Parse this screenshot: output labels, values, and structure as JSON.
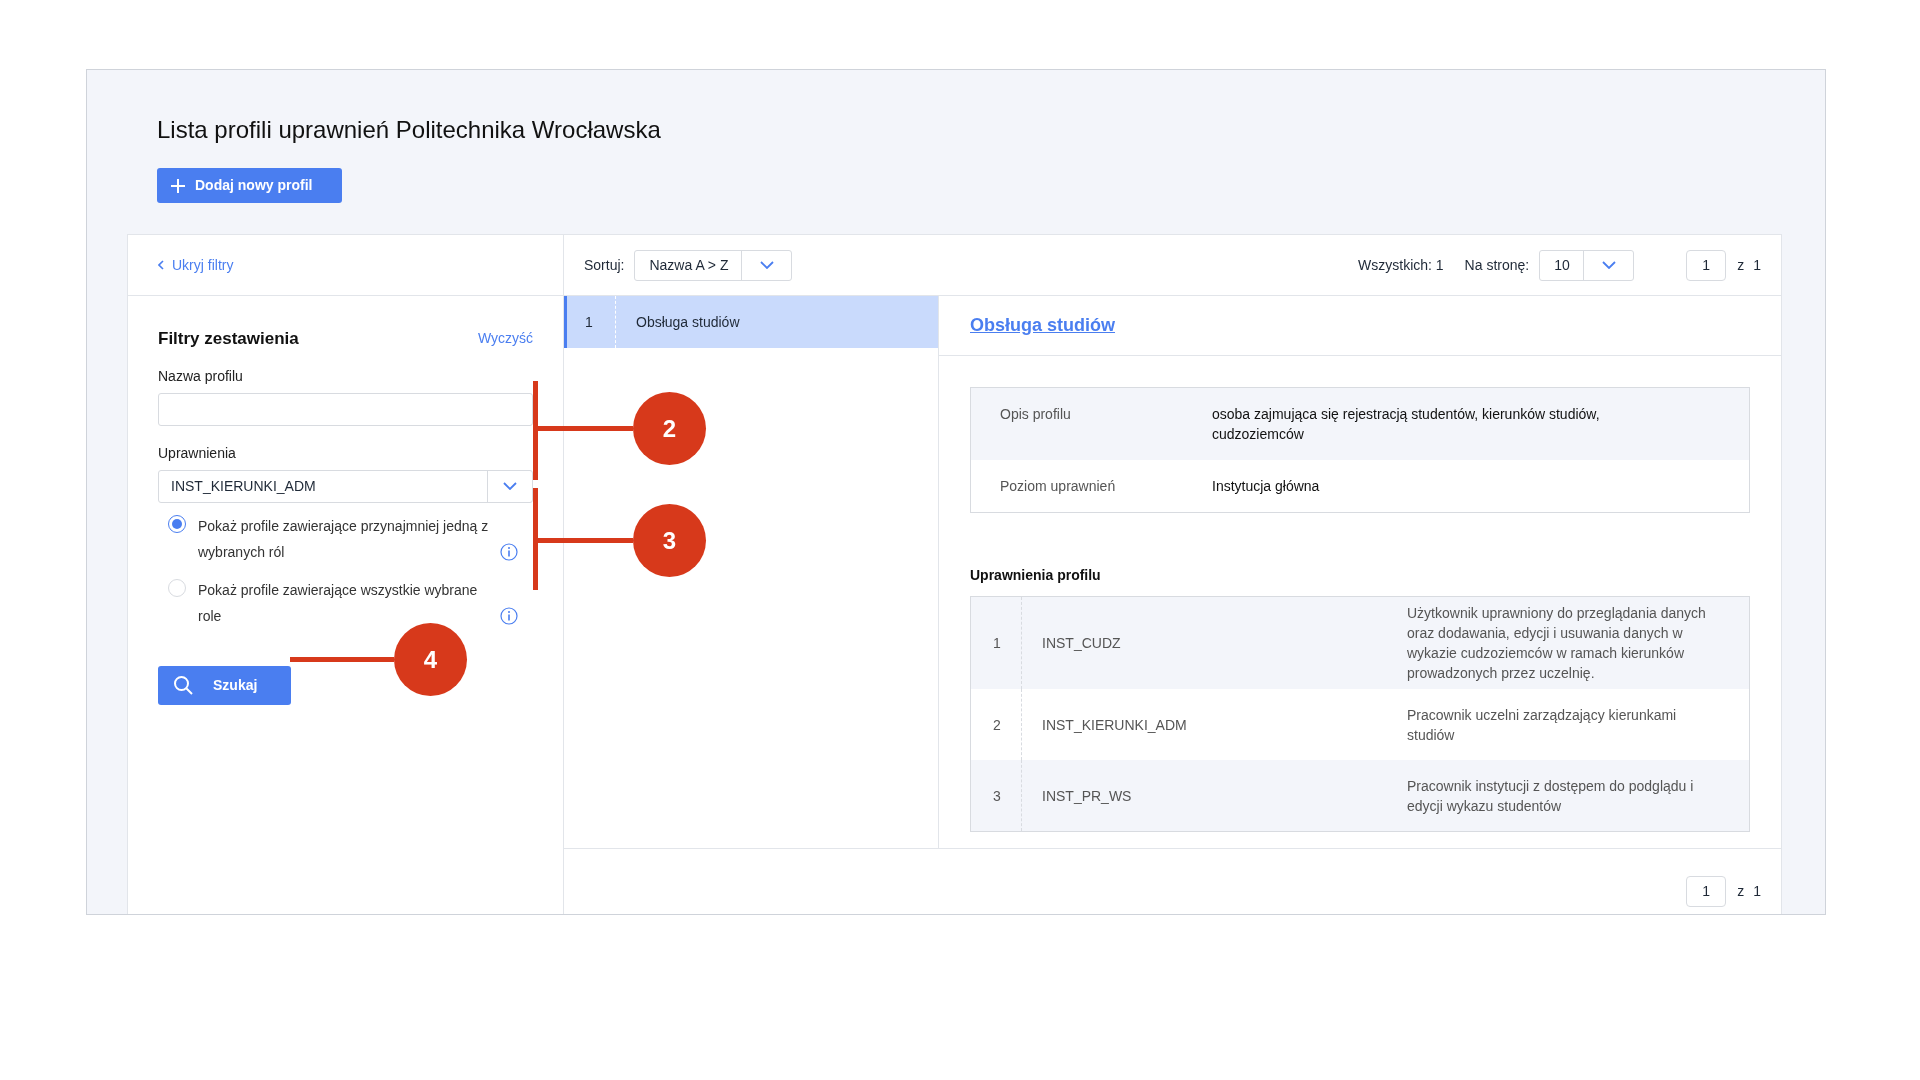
{
  "page": {
    "title": "Lista profili uprawnień Politechnika Wrocławska",
    "add_button": "Dodaj nowy profil"
  },
  "filters": {
    "toggle_link": "Ukryj filtry",
    "heading": "Filtry zestawienia",
    "clear_link": "Wyczyść",
    "fields": [
      {
        "kind": "text",
        "label": "Nazwa profilu"
      },
      {
        "kind": "select",
        "label": "Uprawnienia",
        "value": "INST_KIERUNKI_ADM"
      }
    ],
    "options": [
      {
        "label": "Pokaż profile zawierające przynajmniej jedną z wybranych ról",
        "selected": true
      },
      {
        "label": "Pokaż profile zawierające wszystkie wybrane role",
        "selected": false
      }
    ],
    "search_button": "Szukaj"
  },
  "toolbar": {
    "sort_label": "Sortuj:",
    "sort_value": "Nazwa A > Z",
    "total": "Wszystkich: 1",
    "per_page_label": "Na stronę:",
    "per_page_value": "10",
    "page": "1",
    "of": "z",
    "pages": "1"
  },
  "list": [
    {
      "number": "1",
      "name": "Obsługa studiów",
      "selected": true
    }
  ],
  "detail": {
    "title": "Obsługa studiów",
    "info": [
      {
        "label": "Opis profilu",
        "value": "osoba zajmująca się rejestracją studentów, kierunków studiów, cudzoziemców"
      },
      {
        "label": "Poziom uprawnień",
        "value": "Instytucja główna"
      }
    ],
    "permissions_heading": "Uprawnienia profilu",
    "permissions": [
      {
        "number": "1",
        "code": "INST_CUDZ",
        "description": "Użytkownik uprawniony do przeglądania danych oraz dodawania, edycji i usuwania danych w wykazie cudzoziemców w ramach kierunków prowadzonych przez uczelnię."
      },
      {
        "number": "2",
        "code": "INST_KIERUNKI_ADM",
        "description": "Pracownik uczelni zarządzający kierunkami studiów"
      },
      {
        "number": "3",
        "code": "INST_PR_WS",
        "description": "Pracownik instytucji z dostępem do podglądu i edycji wykazu studentów"
      }
    ]
  },
  "bottom_pagination": {
    "page": "1",
    "of": "z",
    "pages": "1"
  },
  "callouts": [
    {
      "label": "2"
    },
    {
      "label": "3"
    },
    {
      "label": "4"
    }
  ]
}
